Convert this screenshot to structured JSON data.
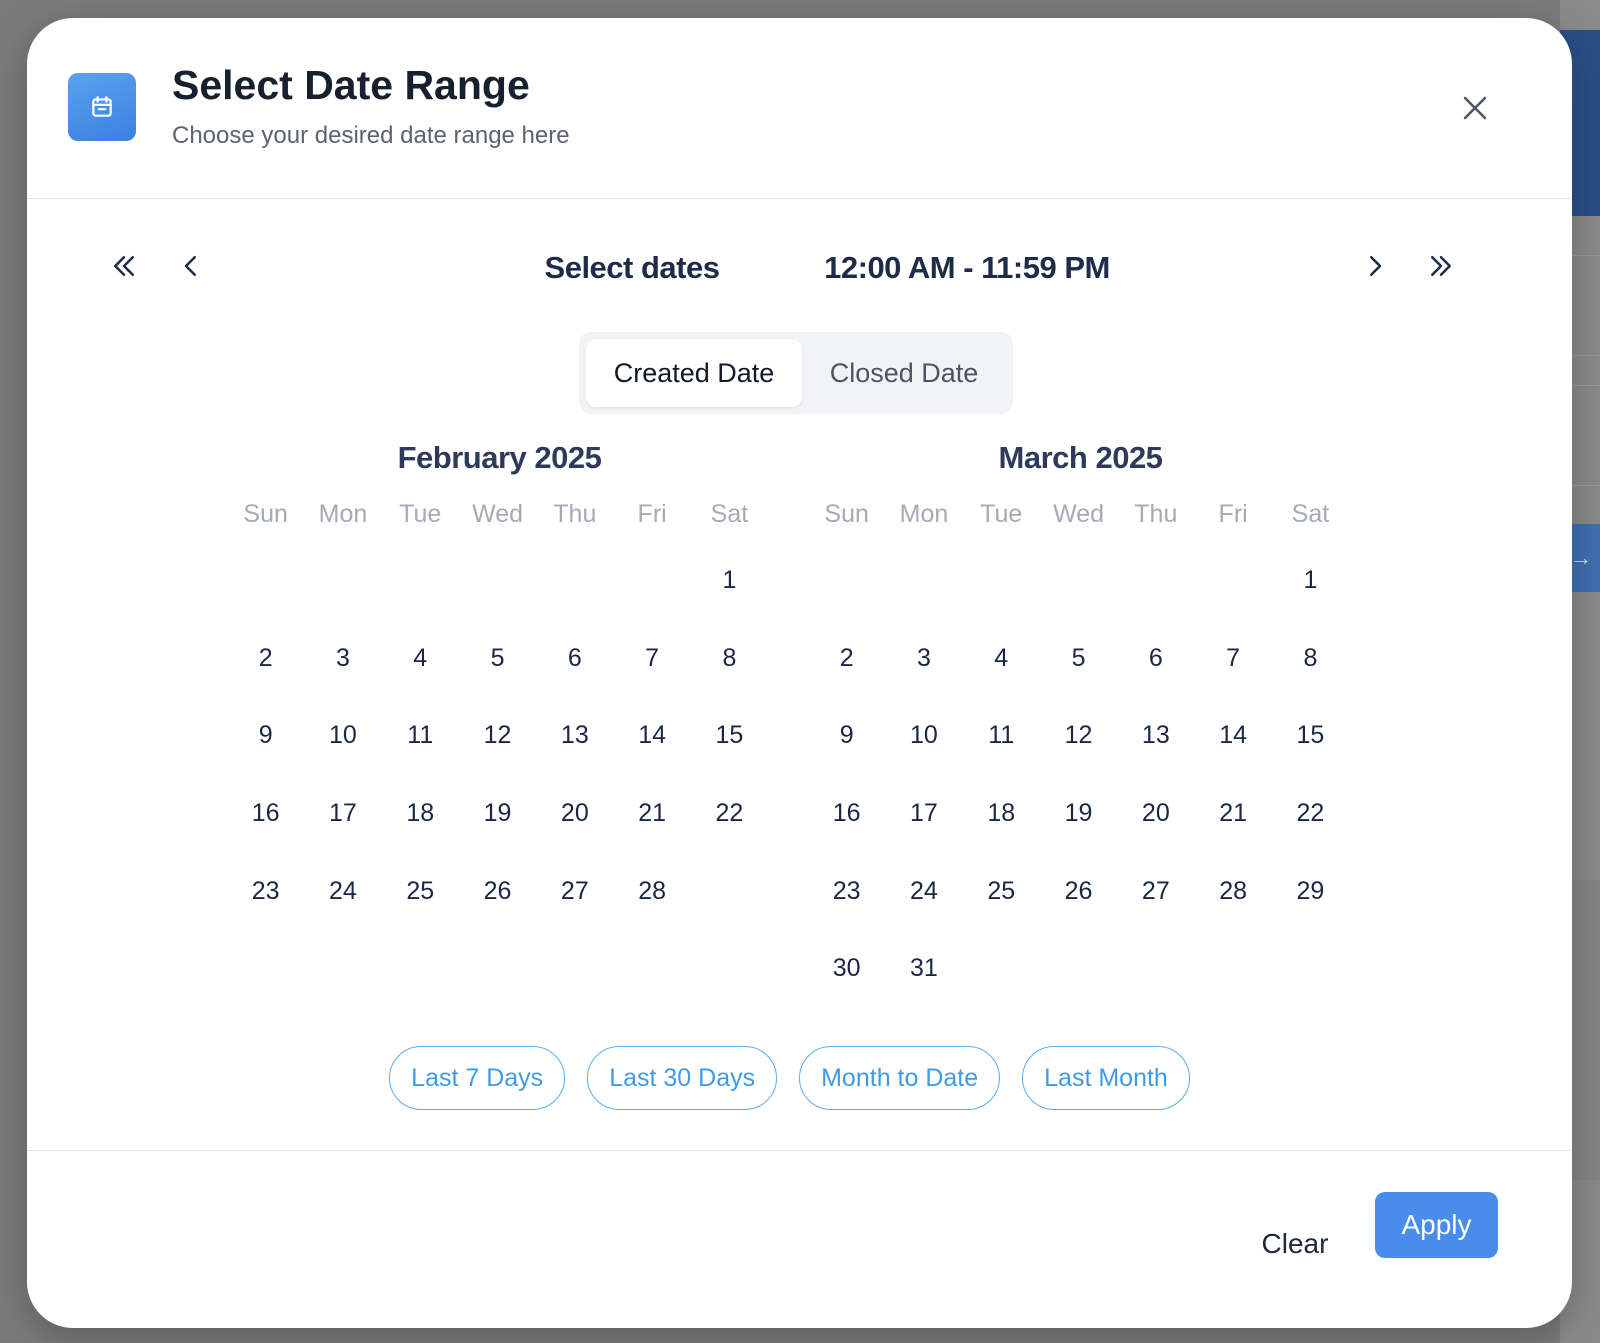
{
  "dialog": {
    "title": "Select Date Range",
    "subtitle": "Choose your desired date range here",
    "icon": "calendar-icon"
  },
  "navigation": {
    "select_label": "Select dates",
    "time_range": "12:00 AM - 11:59 PM"
  },
  "date_type_toggle": {
    "options": [
      "Created Date",
      "Closed Date"
    ],
    "selected": "Created Date"
  },
  "weekdays": [
    "Sun",
    "Mon",
    "Tue",
    "Wed",
    "Thu",
    "Fri",
    "Sat"
  ],
  "months": [
    {
      "title": "February 2025",
      "weeks": [
        [
          "",
          "",
          "",
          "",
          "",
          "",
          "1"
        ],
        [
          "2",
          "3",
          "4",
          "5",
          "6",
          "7",
          "8"
        ],
        [
          "9",
          "10",
          "11",
          "12",
          "13",
          "14",
          "15"
        ],
        [
          "16",
          "17",
          "18",
          "19",
          "20",
          "21",
          "22"
        ],
        [
          "23",
          "24",
          "25",
          "26",
          "27",
          "28",
          ""
        ]
      ]
    },
    {
      "title": "March 2025",
      "weeks": [
        [
          "",
          "",
          "",
          "",
          "",
          "",
          "1"
        ],
        [
          "2",
          "3",
          "4",
          "5",
          "6",
          "7",
          "8"
        ],
        [
          "9",
          "10",
          "11",
          "12",
          "13",
          "14",
          "15"
        ],
        [
          "16",
          "17",
          "18",
          "19",
          "20",
          "21",
          "22"
        ],
        [
          "23",
          "24",
          "25",
          "26",
          "27",
          "28",
          "29"
        ],
        [
          "30",
          "31",
          "",
          "",
          "",
          "",
          ""
        ]
      ]
    }
  ],
  "presets": [
    "Last 7 Days",
    "Last 30 Days",
    "Month to Date",
    "Last Month"
  ],
  "footer": {
    "clear_label": "Clear",
    "apply_label": "Apply"
  },
  "colors": {
    "accent": "#4a8cec",
    "preset_border": "#5aaef0",
    "title_text": "#16202e",
    "day_text": "#1a2744"
  }
}
